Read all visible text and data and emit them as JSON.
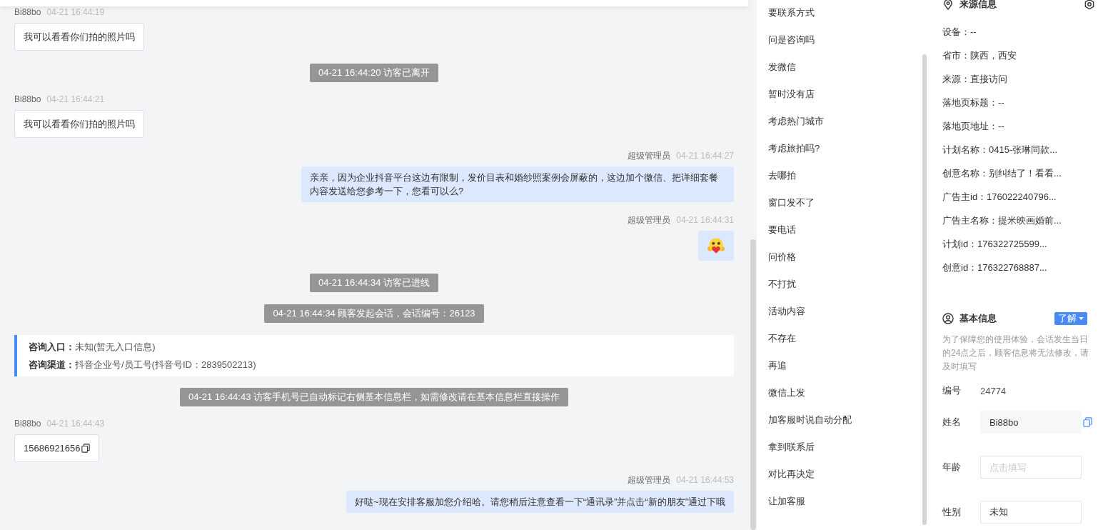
{
  "chat": {
    "messages": [
      {
        "kind": "visitor",
        "sender": "Bi88bo",
        "time": "04-21 16:44:19",
        "text": "我可以看看你们拍的照片吗",
        "copyable": false
      },
      {
        "kind": "system",
        "text": "04-21 16:44:20 访客已离开"
      },
      {
        "kind": "visitor",
        "sender": "Bi88bo",
        "time": "04-21 16:44:21",
        "text": "我可以看看你们拍的照片吗",
        "copyable": false
      },
      {
        "kind": "agent",
        "sender": "超级管理员",
        "time": "04-21 16:44:27",
        "text": "亲亲，因为企业抖音平台这边有限制，发价目表和婚纱照案例会屏蔽的，这边加个微信、把详细套餐内容发送给您参考一下，您看可以么?"
      },
      {
        "kind": "agent_emoji",
        "sender": "超级管理员",
        "time": "04-21 16:44:31"
      },
      {
        "kind": "system",
        "text": "04-21 16:44:34 访客已进线"
      },
      {
        "kind": "system",
        "text": "04-21 16:44:34 顾客发起会话，会话编号：26123"
      },
      {
        "kind": "info",
        "lines": [
          "**咨询入口：**未知(暂无入口信息)",
          "**咨询渠道：**抖音企业号/员工号(抖音号ID：2839502213)"
        ]
      },
      {
        "kind": "system",
        "text": "04-21 16:44:43 访客手机号已自动标记右侧基本信息栏，如需修改请在基本信息栏直接操作"
      },
      {
        "kind": "visitor",
        "sender": "Bi88bo",
        "time": "04-21 16:44:43",
        "text": "15686921656",
        "copyable": true
      },
      {
        "kind": "agent",
        "sender": "超级管理员",
        "time": "04-21 16:44:53",
        "text": "好哒~现在安排客服加您介绍哈。请您稍后注意查看一下“通讯录”并点击“新的朋友”通过下哦"
      }
    ]
  },
  "quick_replies": [
    "要联系方式",
    "问是咨询吗",
    "发微信",
    "暂时没有店",
    "考虑热门城市",
    "考虑旅拍吗?",
    "去哪拍",
    "窗口发不了",
    "要电话",
    "问价格",
    "不打扰",
    "活动内容",
    "不存在",
    "再追",
    "微信上发",
    "加客服时说自动分配",
    "拿到联系后",
    "对比再决定",
    "让加客服"
  ],
  "source_info": {
    "title": "来源信息",
    "fields": [
      "设备：--",
      "省市：陕西，西安",
      "来源：直接访问",
      "落地页标题：--",
      "落地页地址：--",
      "计划名称：0415-张琳同款...",
      "创意名称：别纠结了！看看...",
      "广告主id：176022240796...",
      "广告主名称：提米映画婚前...",
      "计划id：176322725599...",
      "创意id：176322768887..."
    ]
  },
  "basic_info": {
    "title": "基本信息",
    "help_button": "了解",
    "note": "为了保障您的使用体验，会话发生当日的24点之后，顾客信息将无法修改，请及时填写",
    "fields": [
      {
        "kind": "static",
        "label": "编号",
        "value": "24774"
      },
      {
        "kind": "readonly",
        "label": "姓名",
        "value": "Bi88bo"
      },
      {
        "kind": "input",
        "label": "年龄",
        "placeholder": "点击填写"
      },
      {
        "kind": "input",
        "label": "性别",
        "value": "未知"
      }
    ]
  }
}
